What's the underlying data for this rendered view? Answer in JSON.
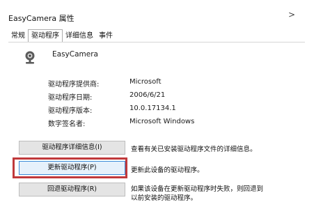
{
  "window": {
    "title": "EasyCamera 属性",
    "close_glyph": ">"
  },
  "tabs": [
    {
      "label": "常规"
    },
    {
      "label": "驱动程序"
    },
    {
      "label": "详细信息"
    },
    {
      "label": "事件"
    }
  ],
  "device": {
    "name": "EasyCamera"
  },
  "properties": [
    {
      "label": "驱动程序提供商:",
      "value": "Microsoft"
    },
    {
      "label": "驱动程序日期:",
      "value": "2006/6/21"
    },
    {
      "label": "驱动程序版本:",
      "value": "10.0.17134.1"
    },
    {
      "label": "数字签名者:",
      "value": "Microsoft Windows"
    }
  ],
  "buttons": {
    "details": {
      "label": "驱动程序详细信息(I)",
      "desc": "查看有关已安装驱动程序文件的详细信息。"
    },
    "update": {
      "label": "更新驱动程序(P)",
      "desc": "更新此设备的驱动程序。"
    },
    "rollback": {
      "label": "回退驱动程序(R)",
      "desc_line1": "如果该设备在更新驱动程序时失败，则回退到",
      "desc_line2": "以前安装的驱动程序。"
    }
  },
  "colors": {
    "highlight_border": "#c0393b",
    "focus_blue": "#3c8ad8"
  }
}
